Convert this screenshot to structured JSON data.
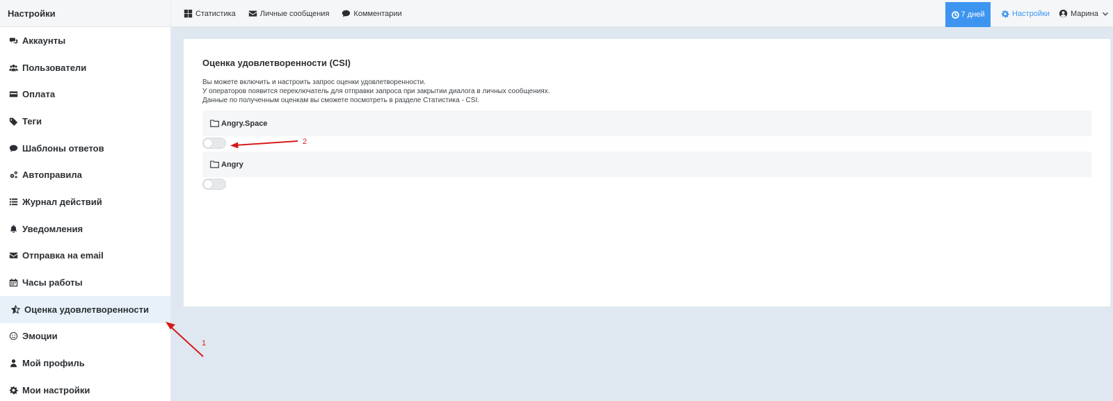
{
  "sidebar": {
    "title": "Настройки",
    "items": [
      {
        "label": "Аккаунты",
        "icon": "chat-bubbles-icon"
      },
      {
        "label": "Пользователи",
        "icon": "users-icon"
      },
      {
        "label": "Оплата",
        "icon": "credit-card-icon"
      },
      {
        "label": "Теги",
        "icon": "tag-icon"
      },
      {
        "label": "Шаблоны ответов",
        "icon": "comment-icon"
      },
      {
        "label": "Автоправила",
        "icon": "gears-icon"
      },
      {
        "label": "Журнал действий",
        "icon": "list-icon"
      },
      {
        "label": "Уведомления",
        "icon": "bell-icon"
      },
      {
        "label": "Отправка на email",
        "icon": "envelope-icon"
      },
      {
        "label": "Часы работы",
        "icon": "calendar-icon"
      },
      {
        "label": "Оценка удовлетворенности",
        "icon": "star-half-icon",
        "active": true
      },
      {
        "label": "Эмоции",
        "icon": "smile-icon"
      },
      {
        "label": "Мой профиль",
        "icon": "user-icon"
      },
      {
        "label": "Мои настройки",
        "icon": "gear-icon"
      }
    ]
  },
  "topbar": {
    "nav": [
      {
        "label": "Статистика",
        "icon": "dashboard-icon"
      },
      {
        "label": "Личные сообщения",
        "icon": "envelope-icon"
      },
      {
        "label": "Комментарии",
        "icon": "comment-icon"
      }
    ],
    "period_label": "7 дней",
    "settings_label": "Настройки",
    "user_name": "Марина"
  },
  "content": {
    "title": "Оценка удовлетворенности (CSI)",
    "description": [
      "Вы можете включить и настроить запрос оценки удовлетворенности.",
      "У операторов появится переключатель для отправки запроса при закрытии диалога в личных сообщениях.",
      "Данные по полученным оценкам вы сможете посмотреть в разделе Статистика - CSI."
    ],
    "groups": [
      {
        "name": "Angry.Space",
        "csi_enabled": false
      },
      {
        "name": "Angry",
        "csi_enabled": false
      }
    ]
  },
  "annotations": [
    "1",
    "2"
  ],
  "colors": {
    "accent": "#3d95f0",
    "active_item_bg": "#e8f1fa",
    "page_bg": "#dfe8f0",
    "annotation": "#d61a1a"
  }
}
